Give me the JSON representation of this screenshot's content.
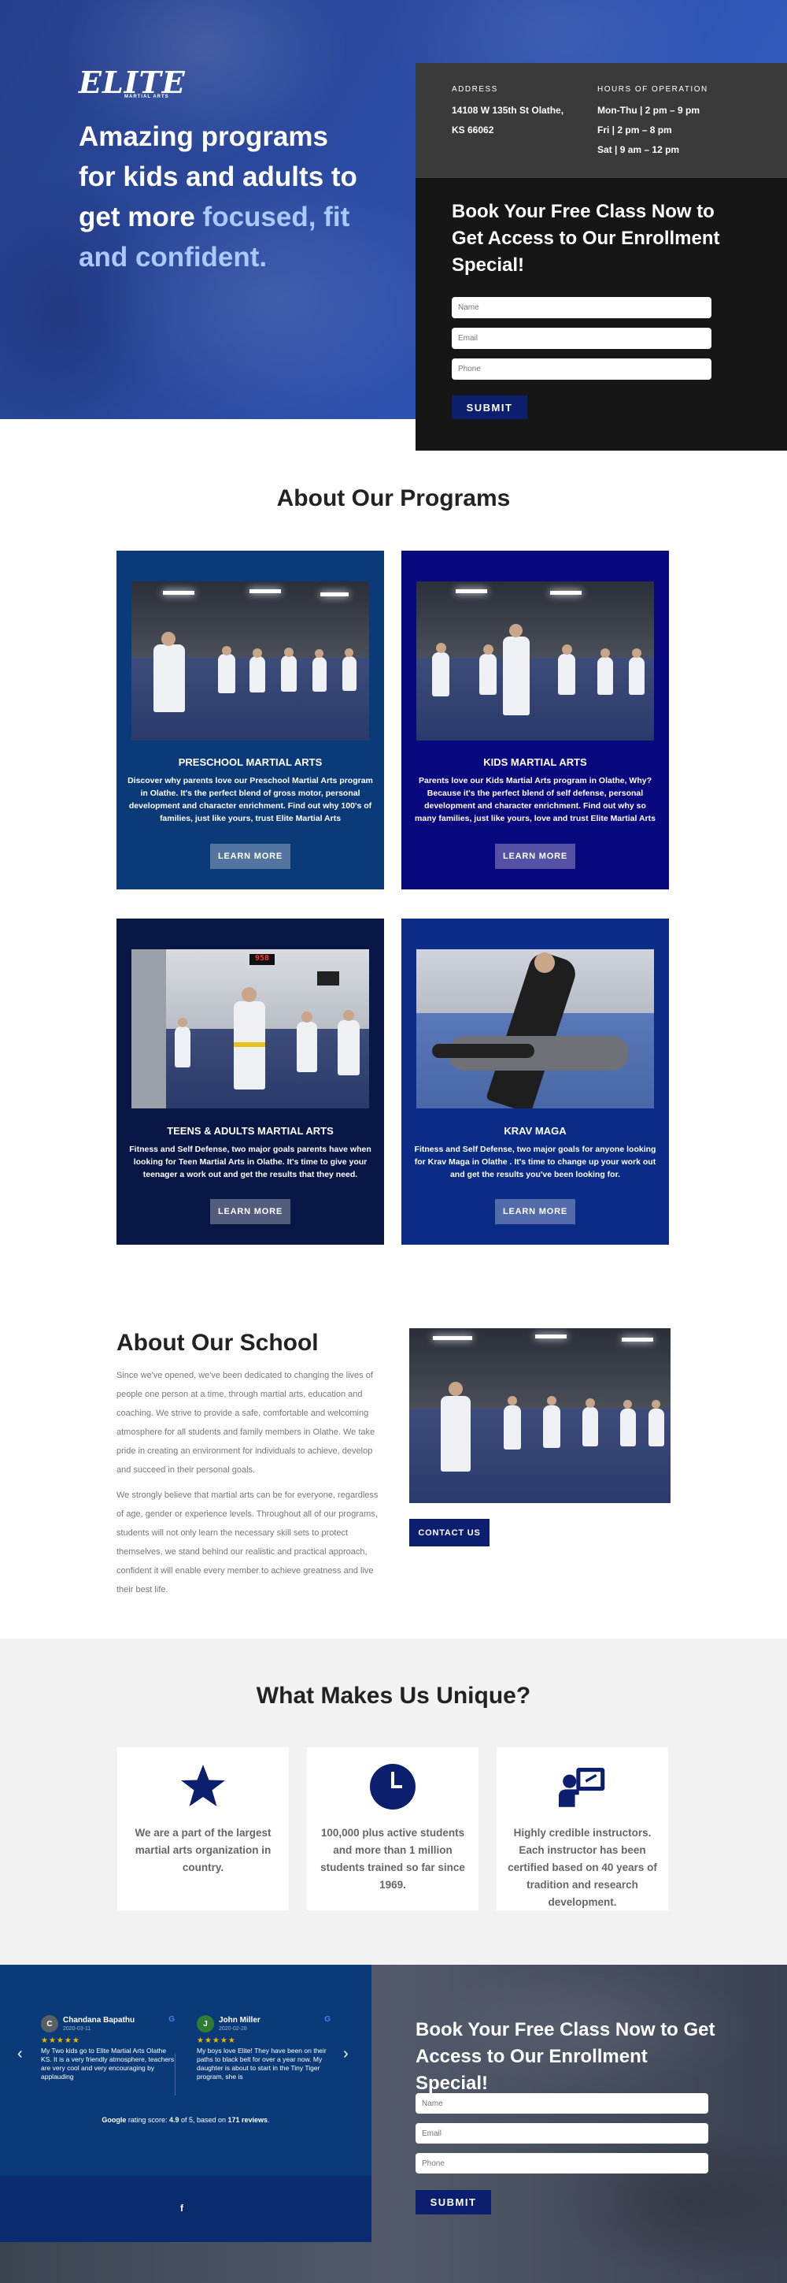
{
  "brand": {
    "logo_text": "ELITE",
    "logo_sub": "MARTIAL ARTS"
  },
  "hero": {
    "headline_part1": "Amazing programs for kids and adults to get more ",
    "headline_highlight": "focused, fit and confident."
  },
  "info": {
    "address_label": "ADDRESS",
    "address_line1": "14108 W 135th St Olathe,",
    "address_line2": "KS 66062",
    "hours_label": "HOURS OF OPERATION",
    "hours_line1": "Mon-Thu | 2 pm – 9 pm",
    "hours_line2": "Fri | 2 pm – 8 pm",
    "hours_line3": "Sat | 9 am – 12 pm"
  },
  "top_form": {
    "title": "Book Your Free Class Now to Get Access to Our Enrollment Special!",
    "name_placeholder": "Name",
    "email_placeholder": "Email",
    "phone_placeholder": "Phone",
    "submit_label": "SUBMIT"
  },
  "programs": {
    "title": "About Our Programs",
    "cards": [
      {
        "title": "PRESCHOOL MARTIAL ARTS",
        "desc": "Discover why parents love our Preschool Martial Arts program in Olathe. It's the perfect blend of gross motor, personal development and character enrichment. Find out why 100's of families, just like yours, trust Elite Martial Arts",
        "button": "LEARN MORE",
        "color": "#0b3a78"
      },
      {
        "title": "KIDS MARTIAL ARTS",
        "desc": "Parents love our Kids Martial Arts program in Olathe, Why? Because it's the perfect blend of self defense, personal development and character enrichment. Find out why so many families, just like yours, love and trust Elite Martial Arts",
        "button": "LEARN MORE",
        "color": "#09087e"
      },
      {
        "title": "TEENS & ADULTS MARTIAL ARTS",
        "desc": "Fitness and Self Defense, two major goals parents have when looking for Teen Martial Arts in Olathe. It's time to give your teenager a work out and get the results that they need.",
        "button": "LEARN MORE",
        "color": "#081746"
      },
      {
        "title": "KRAV MAGA",
        "desc": "Fitness and Self Defense, two major goals for anyone looking for Krav Maga in Olathe . It's time to change up your work out and get the results you've been looking for.",
        "button": "LEARN MORE",
        "color": "#0a2b86"
      }
    ]
  },
  "about_school": {
    "title": "About Our School",
    "p1": "Since we've opened, we've been dedicated to changing the lives of people one person at a time, through martial arts, education and coaching. We strive to provide a safe, comfortable and welcoming atmosphere for all students and family members in Olathe. We take pride in creating an environment for individuals to achieve, develop and succeed in their personal goals.",
    "p2": "We strongly believe that martial arts can be for everyone, regardless of age, gender or experience levels. Throughout all of our programs, students will not only learn the necessary skill sets to protect themselves, we stand behind our realistic and practical approach, confident it will enable every member to achieve greatness and live their best life.",
    "contact_label": "CONTACT US"
  },
  "unique": {
    "title": "What Makes Us Unique?",
    "items": [
      {
        "icon": "star-icon",
        "text": "We are a part of the largest martial arts organization in country."
      },
      {
        "icon": "clock-icon",
        "text": "100,000 plus active students and more than 1 million students trained so far since 1969."
      },
      {
        "icon": "instructor-icon",
        "text": "Highly credible instructors. Each instructor has been certified based on 40 years of tradition and research development."
      }
    ],
    "accent": "#0c1f6e"
  },
  "reviews": {
    "items": [
      {
        "initial": "C",
        "name": "Chandana Bapathu",
        "date": "2020-03-11",
        "stars": "★★★★★",
        "text": "My Two kids go to Elite Martial Arts Olathe KS. It is a very friendly atmosphere, teachers are very cool and very encouraging by applauding",
        "avatar_color": "#5a5f66"
      },
      {
        "initial": "J",
        "name": "John Miller",
        "date": "2020-02-28",
        "stars": "★★★★★",
        "text": "My boys love Elite! They have been on their paths to black belt for over a year now. My daughter is about to start in the Tiny Tiger program, she is",
        "avatar_color": "#2e7d32"
      }
    ],
    "google_badge": "G",
    "rating_prefix": "Google",
    "rating_mid": " rating score: ",
    "rating_score": "4.9",
    "rating_of": " of 5, based on ",
    "rating_count": "171 reviews",
    "rating_end": ".",
    "prev_arrow": "‹",
    "next_arrow": "›",
    "facebook_icon": "f"
  },
  "bottom_form": {
    "title": "Book Your Free Class Now to Get Access to Our Enrollment Special!",
    "name_placeholder": "Name",
    "email_placeholder": "Email",
    "phone_placeholder": "Phone",
    "submit_label": "SUBMIT"
  }
}
